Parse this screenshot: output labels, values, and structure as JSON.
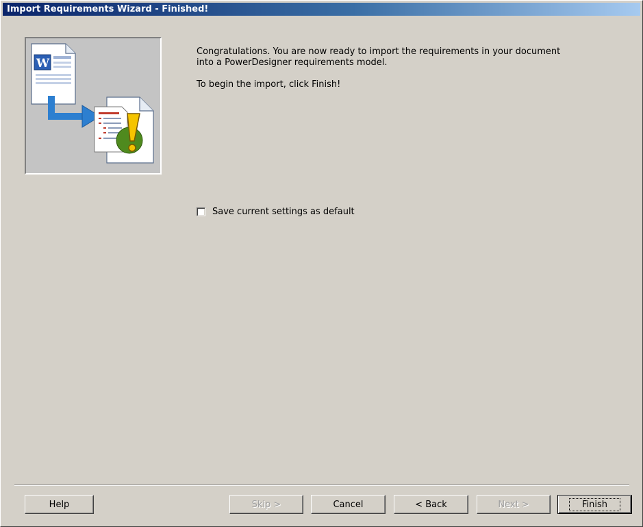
{
  "window": {
    "title": "Import Requirements Wizard - Finished!"
  },
  "illustration": {
    "icon": "word-document-import-to-requirements-icon"
  },
  "message": {
    "line1": "Congratulations. You are now ready to import the requirements in your document",
    "line2": "into a PowerDesigner requirements model.",
    "line3": "To begin the import, click Finish!"
  },
  "options": {
    "save_default_label": "Save current settings as default",
    "save_default_checked": false
  },
  "buttons": {
    "help": "Help",
    "skip": "Skip >",
    "cancel": "Cancel",
    "back": "< Back",
    "next": "Next >",
    "finish": "Finish"
  },
  "colors": {
    "titlebar_start": "#0a246a",
    "titlebar_end": "#a6caf0",
    "dialog_bg": "#d4d0c8"
  }
}
